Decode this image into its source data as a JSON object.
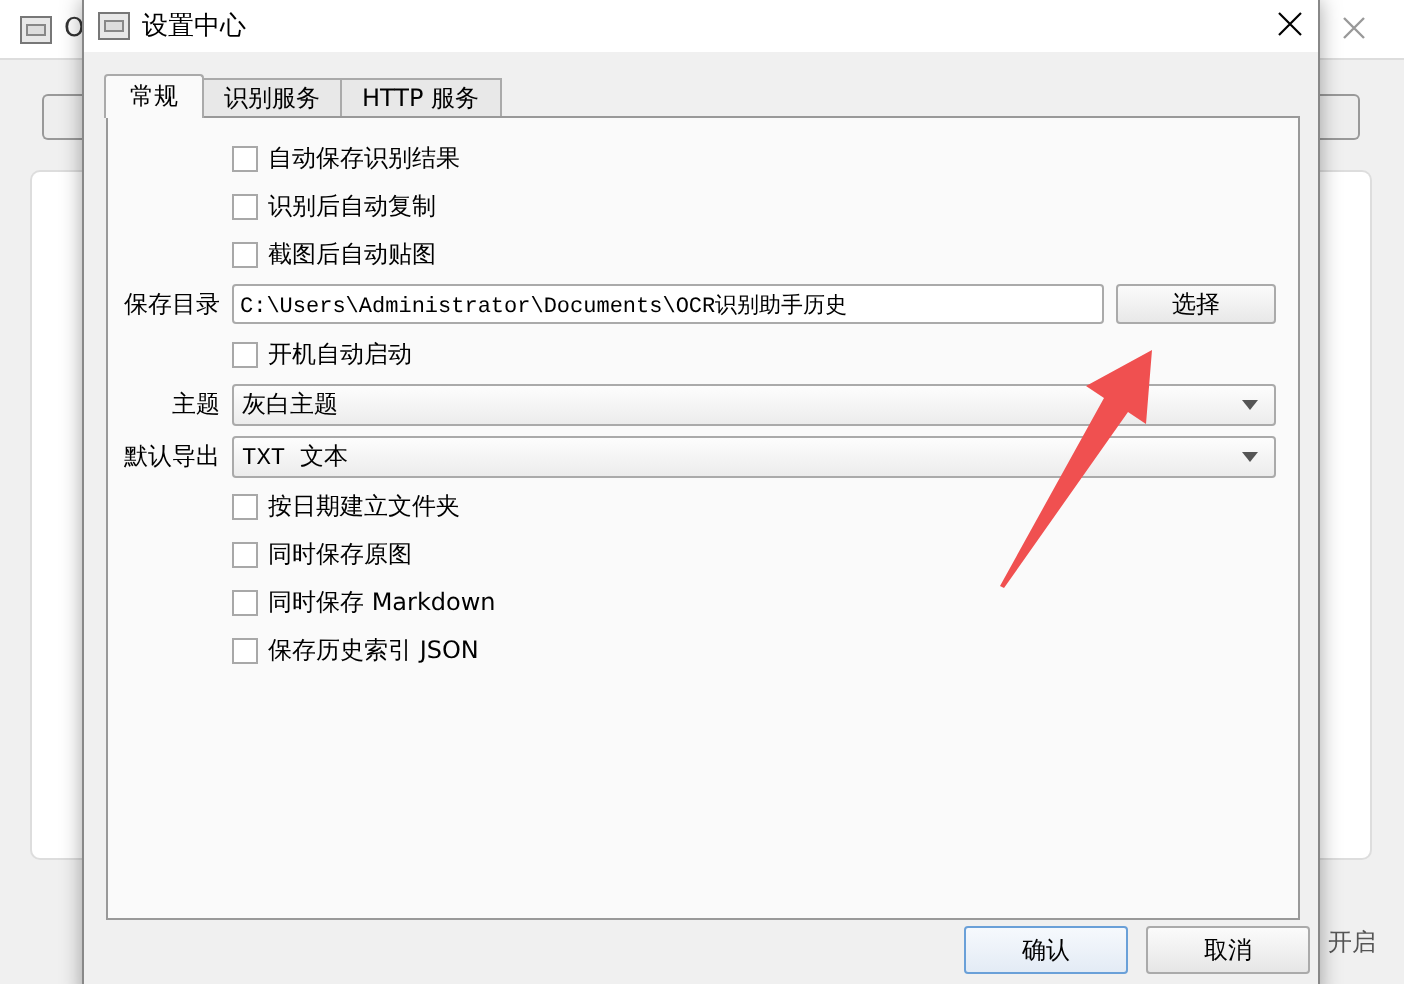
{
  "background_window": {
    "title": "O",
    "status": "开启"
  },
  "dialog": {
    "title": "设置中心"
  },
  "tabs": [
    {
      "label": "常规",
      "selected": true
    },
    {
      "label": "识别服务",
      "selected": false
    },
    {
      "label": "HTTP 服务",
      "selected": false
    }
  ],
  "settings": [
    {
      "kind": "checkbox",
      "label": "自动保存识别结果",
      "checked": false
    },
    {
      "kind": "checkbox",
      "label": "识别后自动复制",
      "checked": false
    },
    {
      "kind": "checkbox",
      "label": "截图后自动贴图",
      "checked": false
    },
    {
      "kind": "path",
      "label": "保存目录",
      "value": "C:\\Users\\Administrator\\Documents\\OCR识别助手历史",
      "button": "选择"
    },
    {
      "kind": "checkbox",
      "label": "开机自动启动",
      "checked": false
    },
    {
      "kind": "combo",
      "label": "主题",
      "value": "灰白主题"
    },
    {
      "kind": "combo",
      "label": "默认导出",
      "value": "TXT 文本"
    },
    {
      "kind": "checkbox",
      "label": "按日期建立文件夹",
      "checked": false
    },
    {
      "kind": "checkbox",
      "label": "同时保存原图",
      "checked": false
    },
    {
      "kind": "checkbox",
      "label": "同时保存 Markdown",
      "checked": false
    },
    {
      "kind": "checkbox",
      "label": "保存历史索引 JSON",
      "checked": false
    }
  ],
  "buttons": [
    {
      "label": "确认",
      "default": true
    },
    {
      "label": "取消",
      "default": false
    }
  ]
}
